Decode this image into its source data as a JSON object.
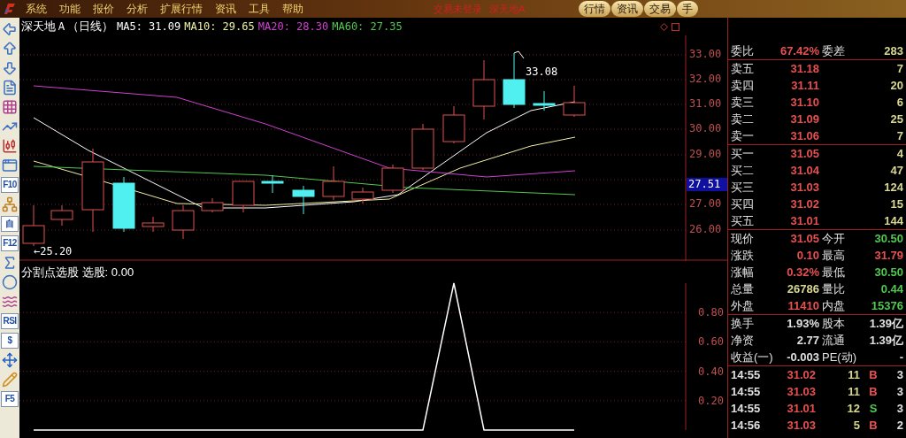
{
  "menu_bar": {
    "items": [
      "系统",
      "功能",
      "报价",
      "分析",
      "扩展行情",
      "资讯",
      "工具",
      "帮助"
    ],
    "status_text": "交易未登录",
    "stock_name": "深天地A",
    "tabs": [
      "行情",
      "资讯",
      "交易",
      "手"
    ]
  },
  "toolbar": [
    {
      "kind": "arrow-left"
    },
    {
      "kind": "arrow-up"
    },
    {
      "kind": "arrow-down"
    },
    {
      "kind": "report"
    },
    {
      "kind": "grid"
    },
    {
      "kind": "line"
    },
    {
      "kind": "candles"
    },
    {
      "kind": "windows"
    },
    {
      "kind": "text",
      "label": "F10"
    },
    {
      "kind": "tree"
    },
    {
      "kind": "text",
      "label": "自"
    },
    {
      "kind": "text",
      "label": "F12"
    },
    {
      "kind": "formula"
    },
    {
      "kind": "circle"
    },
    {
      "kind": "wave"
    },
    {
      "kind": "text",
      "label": "RSI"
    },
    {
      "kind": "text",
      "label": "$"
    },
    {
      "kind": "move"
    },
    {
      "kind": "pencil"
    },
    {
      "kind": "text",
      "label": "F5"
    }
  ],
  "chart": {
    "title": "深天地Ａ（日线）",
    "indicators": [
      {
        "label": "MA5: 31.09",
        "color": "#ffffff"
      },
      {
        "label": "MA10: 29.65",
        "color": "#f0f0a0"
      },
      {
        "label": "MA20: 28.30",
        "color": "#d040d0"
      },
      {
        "label": "MA60: 27.35",
        "color": "#50c850"
      }
    ],
    "price_axis": [
      "33.00",
      "32.00",
      "31.00",
      "30.00",
      "29.00",
      "27.00",
      "26.00"
    ],
    "current_price_tag": "27.51",
    "high_label": "33.08",
    "low_label": "←25.20"
  },
  "indicator_panel": {
    "title": "分割点选股 选股: 0.00",
    "chart_data": {
      "type": "line",
      "grid": true,
      "series": [
        {
          "color": "#ffffff",
          "values": [
            0,
            0,
            0,
            0,
            0,
            0,
            0,
            0,
            0,
            0,
            0,
            0,
            0,
            0,
            1,
            0,
            0,
            0,
            0
          ]
        }
      ],
      "ylim": [
        0,
        1
      ],
      "yticks": [
        {
          "value": 0.8,
          "label": "0.80"
        },
        {
          "value": 0.6,
          "label": "0.60"
        },
        {
          "value": 0.4,
          "label": "0.40"
        },
        {
          "value": 0.2,
          "label": "0.20"
        }
      ]
    }
  },
  "quote_panel": {
    "ratio_row": {
      "label": "委比",
      "value": "67.42%",
      "label_2": "委差",
      "value_2": "283"
    },
    "sell_orders": [
      {
        "label": "卖五",
        "price": "31.18",
        "volume": "7"
      },
      {
        "label": "卖四",
        "price": "31.11",
        "volume": "20"
      },
      {
        "label": "卖三",
        "price": "31.10",
        "volume": "6"
      },
      {
        "label": "卖二",
        "price": "31.09",
        "volume": "25"
      },
      {
        "label": "卖一",
        "price": "31.06",
        "volume": "7"
      }
    ],
    "buy_orders": [
      {
        "label": "买一",
        "price": "31.05",
        "volume": "4"
      },
      {
        "label": "买二",
        "price": "31.04",
        "volume": "47"
      },
      {
        "label": "买三",
        "price": "31.03",
        "volume": "124"
      },
      {
        "label": "买四",
        "price": "31.02",
        "volume": "15"
      },
      {
        "label": "买五",
        "price": "31.01",
        "volume": "144"
      }
    ],
    "stats": [
      {
        "label": "现价",
        "value": "31.05",
        "color": "#e85050"
      },
      {
        "label": "今开",
        "value": "30.50",
        "color": "#50c850"
      },
      {
        "label": "涨跌",
        "value": "0.10",
        "color": "#e85050"
      },
      {
        "label": "最高",
        "value": "31.79",
        "color": "#e85050"
      },
      {
        "label": "涨幅",
        "value": "0.32%",
        "color": "#e85050"
      },
      {
        "label": "最低",
        "value": "30.50",
        "color": "#50c850"
      },
      {
        "label": "总量",
        "value": "26786",
        "color": "#d8d890"
      },
      {
        "label": "量比",
        "value": "0.44",
        "color": "#50c850"
      },
      {
        "label": "外盘",
        "value": "11410",
        "color": "#e85050"
      },
      {
        "label": "内盘",
        "value": "15376",
        "color": "#50c850"
      }
    ],
    "finance": [
      {
        "label": "换手",
        "value": "1.93%",
        "label_2": "股本",
        "value_2": "1.39亿"
      },
      {
        "label": "净资",
        "value": "2.77",
        "label_2": "流通",
        "value_2": "1.39亿"
      },
      {
        "label": "收益(一)",
        "value": "-0.003",
        "label_2": "PE(动)",
        "value_2": "-"
      }
    ],
    "trades": [
      {
        "time": "14:55",
        "price": "31.02",
        "volume": "11",
        "side": "B",
        "count": "3"
      },
      {
        "time": "14:55",
        "price": "31.03",
        "volume": "11",
        "side": "B",
        "count": "3"
      },
      {
        "time": "14:55",
        "price": "31.01",
        "volume": "12",
        "side": "S",
        "count": "3"
      },
      {
        "time": "14:56",
        "price": "31.03",
        "volume": "5",
        "side": "B",
        "count": "2"
      }
    ]
  }
}
